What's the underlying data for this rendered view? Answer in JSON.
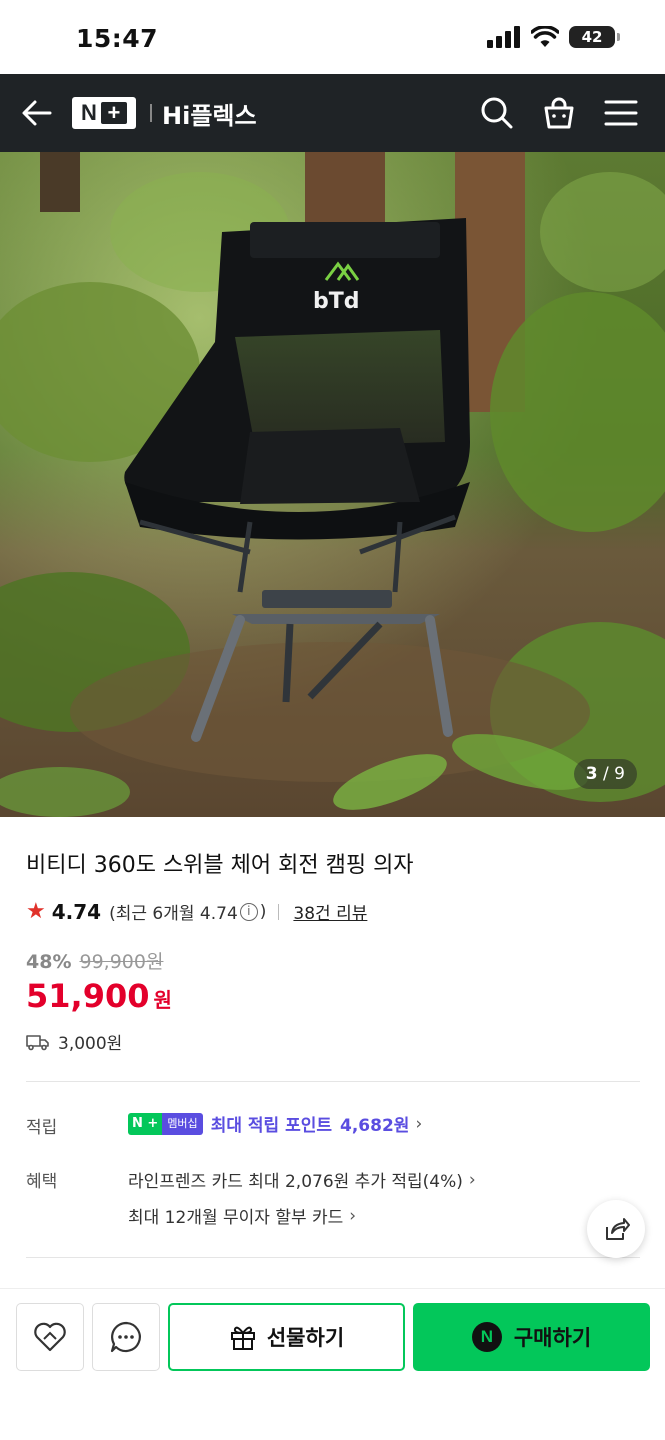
{
  "status": {
    "time": "15:47",
    "battery": "42"
  },
  "nav": {
    "brand_n": "N",
    "brand_plus": "+",
    "store_name": "Hi플렉스"
  },
  "hero": {
    "counter_current": "3",
    "counter_total": "9",
    "chair_logo": "bTd"
  },
  "product": {
    "title": "비티디 360도 스위블 체어 회전 캠핑 의자",
    "rating": "4.74",
    "recent_prefix": "(최근 6개월 4.74",
    "recent_suffix": ")",
    "review_count": "38건 리뷰",
    "discount_pct": "48%",
    "original_price": "99,900원",
    "price": "51,900",
    "price_unit": "원",
    "shipping": "3,000원"
  },
  "benefits": {
    "points_label": "적립",
    "membership_n": "N +",
    "membership_text": "멤버십",
    "points_text": "최대 적립 포인트",
    "points_amount": "4,682원",
    "perks_label": "혜택",
    "perk_1": "라인프렌즈 카드 최대 2,076원 추가 적립(4%)",
    "perk_2": "최대 12개월 무이자 할부 카드"
  },
  "actions": {
    "gift_label": "선물하기",
    "buy_label": "구매하기",
    "buy_badge": "N"
  },
  "colors": {
    "accent_green": "#03c75a",
    "price_red": "#e3002b",
    "membership_purple": "#5a4de0",
    "nav_bg": "#1f2326"
  }
}
